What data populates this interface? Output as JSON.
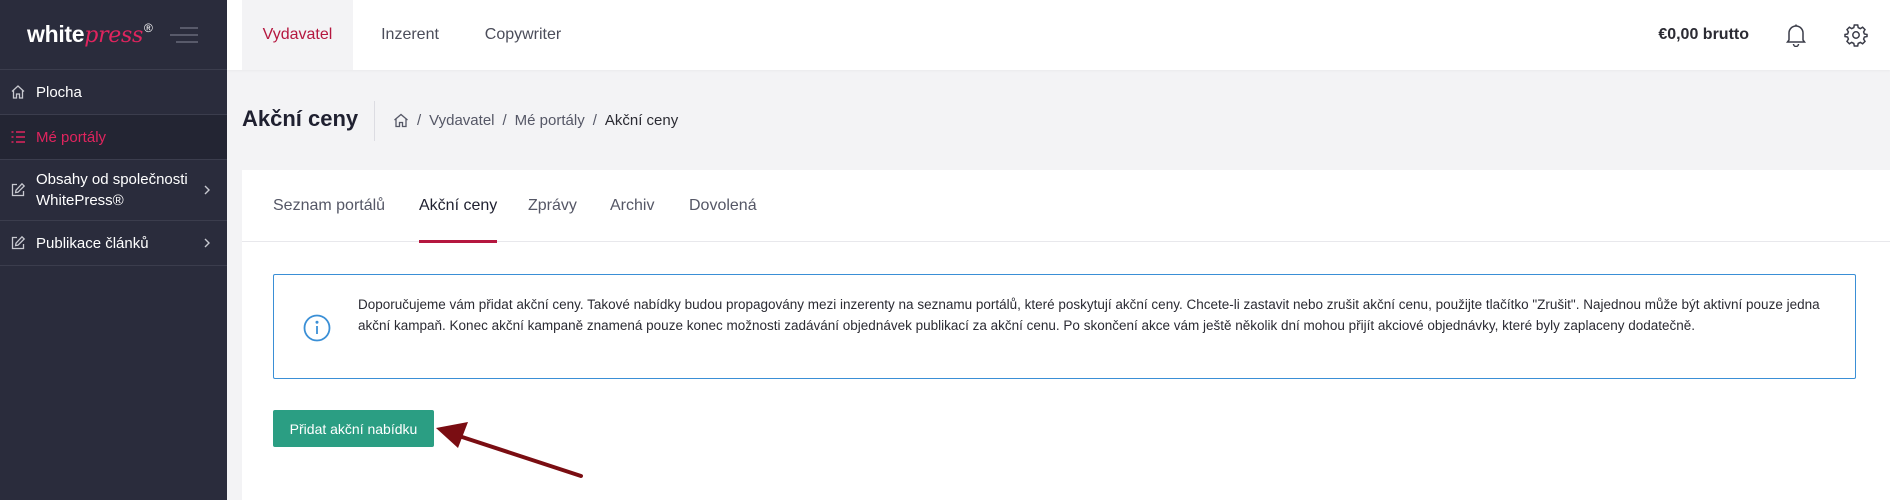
{
  "brand": {
    "logo_part1": "white",
    "logo_part2": "press",
    "logo_reg": "®"
  },
  "sidebar": {
    "items": [
      {
        "label": "Plocha",
        "icon": "home-icon",
        "active": false,
        "has_chevron": false
      },
      {
        "label": "Mé portály",
        "icon": "list-icon",
        "active": true,
        "has_chevron": false
      },
      {
        "label": "Obsahy od společnosti WhitePress®",
        "icon": "edit-icon",
        "active": false,
        "has_chevron": true
      },
      {
        "label": "Publikace článků",
        "icon": "edit-icon",
        "active": false,
        "has_chevron": true
      }
    ]
  },
  "topbar": {
    "tabs": [
      {
        "label": "Vydavatel",
        "active": true
      },
      {
        "label": "Inzerent",
        "active": false
      },
      {
        "label": "Copywriter",
        "active": false
      }
    ],
    "balance": "€0,00 brutto",
    "icons": [
      "bell-icon",
      "gear-icon"
    ]
  },
  "page": {
    "title": "Akční ceny",
    "breadcrumb": {
      "home_icon": "home-icon",
      "items": [
        "Vydavatel",
        "Mé portály",
        "Akční ceny"
      ],
      "separator": "/"
    }
  },
  "content": {
    "tabs": [
      {
        "label": "Seznam portálů",
        "active": false
      },
      {
        "label": "Akční ceny",
        "active": true
      },
      {
        "label": "Zprávy",
        "active": false
      },
      {
        "label": "Archiv",
        "active": false
      },
      {
        "label": "Dovolená",
        "active": false
      }
    ],
    "info": {
      "icon": "info-icon",
      "text": "Doporučujeme vám přidat akční ceny. Takové nabídky budou propagovány mezi inzerenty na seznamu portálů, které poskytují akční ceny. Chcete-li zastavit nebo zrušit akční cenu, použijte tlačítko \"Zrušit\". Najednou může být aktivní pouze jedna akční kampaň. Konec akční kampaně znamená pouze konec možnosti zadávání objednávek publikací za akční cenu. Po skončení akce vám ještě několik dní mohou přijít akciové objednávky, které byly zaplaceny dodatečně."
    },
    "add_button": "Přidat akční nabídku"
  },
  "colors": {
    "sidebar_bg": "#2a2c3c",
    "accent": "#b5173f",
    "brand_pink": "#e0245e",
    "button_green": "#2b9e83",
    "info_border": "#3a8fd6",
    "annotation_arrow": "#7a0d12"
  }
}
